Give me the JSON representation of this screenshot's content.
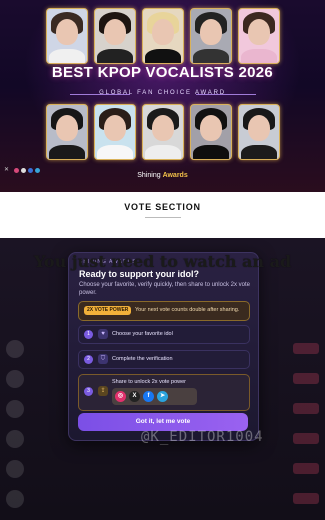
{
  "banner": {
    "title": "BEST KPOP VOCALISTS 2026",
    "subtitle": "GLOBAL FAN CHOICE AWARD",
    "brand_left": "Shining",
    "brand_right": "Awards",
    "corner_mark": "✕",
    "photos_count_top": 5,
    "photos_count_bottom": 5
  },
  "vote_section": {
    "title": "VOTE SECTION"
  },
  "overlay": {
    "ad_text": "You just need to watch an ad"
  },
  "modal": {
    "kicker": "SHINING AWARDS",
    "title": "Ready to support your idol?",
    "description": "Choose your favorite, verify quickly, then share to unlock 2x vote power.",
    "power_badge": "2X VOTE POWER",
    "power_text": "Your next vote counts double after sharing.",
    "steps": [
      {
        "num": "1",
        "icon": "heart-icon",
        "label": "Choose your favorite idol"
      },
      {
        "num": "2",
        "icon": "shield-icon",
        "label": "Complete the verification"
      },
      {
        "num": "3",
        "icon": "share-icon",
        "label": "Share to unlock 2x vote power"
      }
    ],
    "social": [
      "instagram",
      "x",
      "facebook",
      "telegram"
    ],
    "button_label": "Got it, let me vote"
  },
  "watermark": "@K_EDITOR1004",
  "colors": {
    "accent": "#8a5cf0",
    "gold": "#f2b13a",
    "banner_bg": "#160a2a"
  }
}
